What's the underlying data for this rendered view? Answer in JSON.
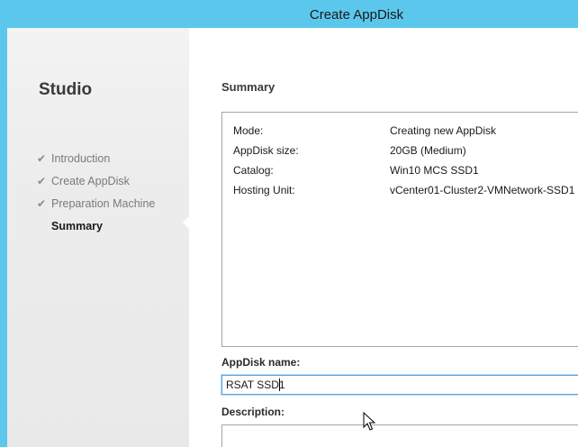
{
  "window": {
    "title": "Create AppDisk"
  },
  "sidebar": {
    "brand": "Studio",
    "steps": [
      {
        "label": "Introduction",
        "completed": true
      },
      {
        "label": "Create AppDisk",
        "completed": true
      },
      {
        "label": "Preparation Machine",
        "completed": true
      },
      {
        "label": "Summary",
        "completed": false,
        "current": true
      }
    ]
  },
  "main": {
    "heading": "Summary",
    "summary": [
      {
        "key": "Mode:",
        "value": "Creating new AppDisk"
      },
      {
        "key": "AppDisk size:",
        "value": "20GB (Medium)"
      },
      {
        "key": "Catalog:",
        "value": "Win10 MCS SSD1"
      },
      {
        "key": "Hosting Unit:",
        "value": "vCenter01-Cluster2-VMNetwork-SSD1"
      }
    ],
    "name_label": "AppDisk name:",
    "name_value": "RSAT SSD1",
    "description_label": "Description:",
    "description_value": ""
  },
  "icons": {
    "step_check": "check-icon",
    "mouse_cursor": "arrow-cursor-icon"
  },
  "colors": {
    "titlebar": "#5bc7ec",
    "sidebar_bg": "#ececec",
    "input_focus_border": "#5aa0d8"
  }
}
